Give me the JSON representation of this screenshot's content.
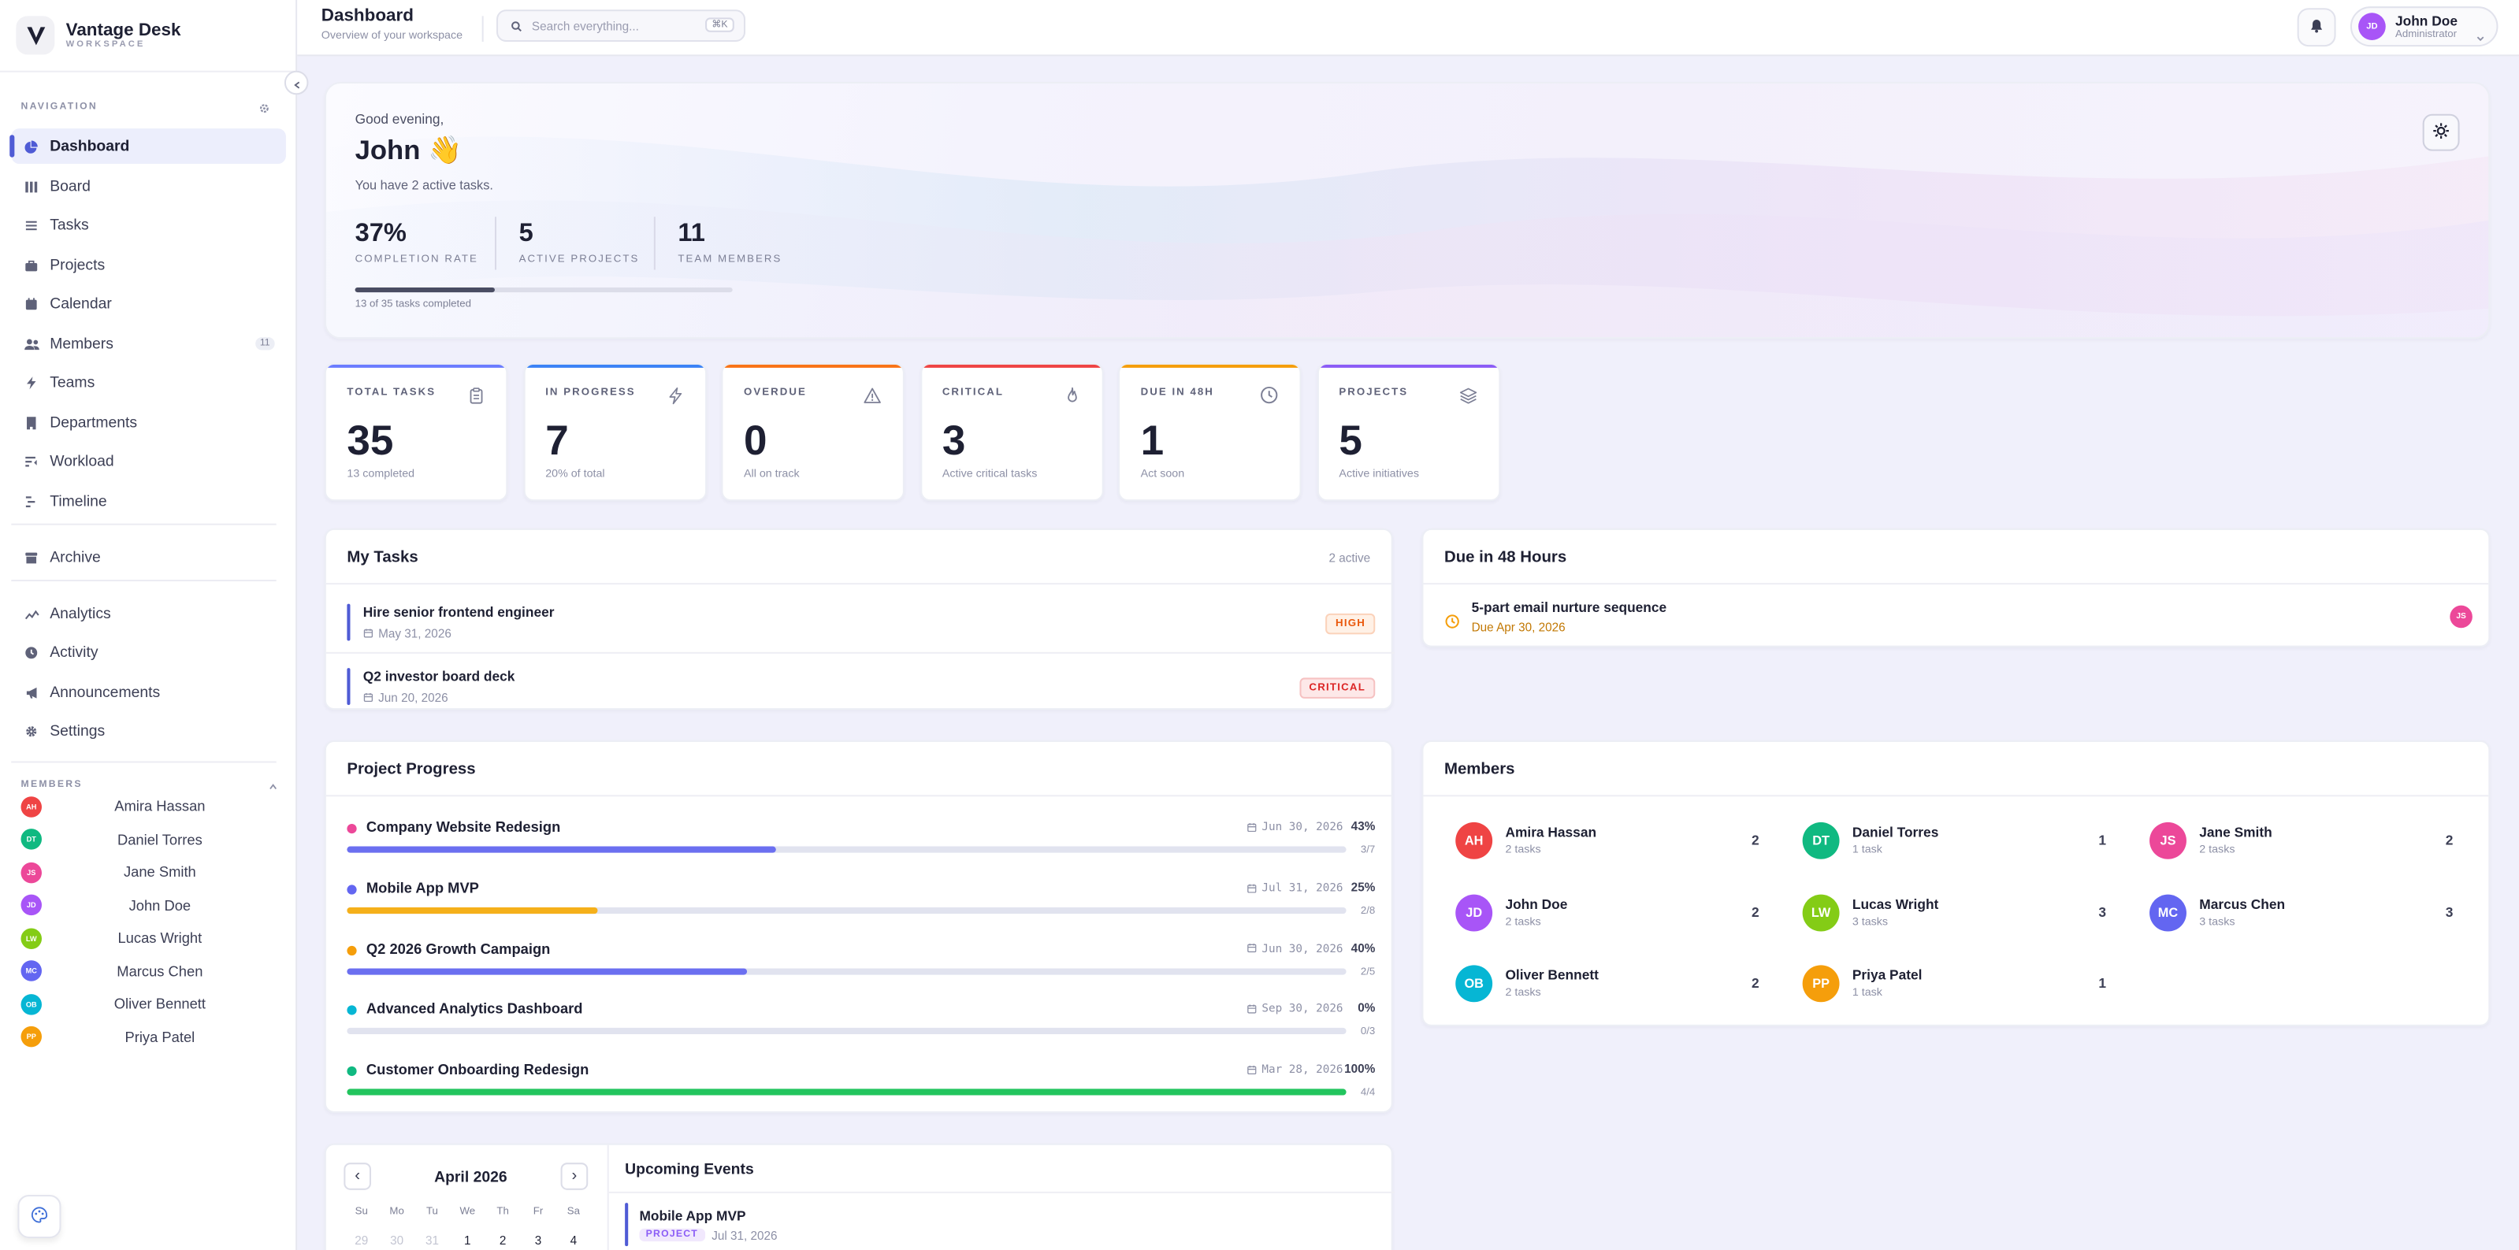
{
  "brand": {
    "name": "Vantage Desk",
    "sub": "WORKSPACE"
  },
  "nav": {
    "caption": "NAVIGATION",
    "items": [
      {
        "label": "Dashboard",
        "icon": "pie-chart-icon"
      },
      {
        "label": "Board",
        "icon": "columns-icon"
      },
      {
        "label": "Tasks",
        "icon": "list-icon"
      },
      {
        "label": "Projects",
        "icon": "briefcase-icon"
      },
      {
        "label": "Calendar",
        "icon": "calendar-icon"
      },
      {
        "label": "Members",
        "icon": "users-icon",
        "badge": "11"
      },
      {
        "label": "Teams",
        "icon": "bolt-icon"
      },
      {
        "label": "Departments",
        "icon": "building-icon"
      },
      {
        "label": "Workload",
        "icon": "workload-icon"
      },
      {
        "label": "Timeline",
        "icon": "timeline-icon"
      },
      {
        "label": "Archive",
        "icon": "archive-icon"
      },
      {
        "label": "Analytics",
        "icon": "analytics-icon"
      },
      {
        "label": "Activity",
        "icon": "clock-icon"
      },
      {
        "label": "Announcements",
        "icon": "megaphone-icon"
      },
      {
        "label": "Settings",
        "icon": "gear-icon"
      }
    ]
  },
  "sidebar_members": {
    "caption": "MEMBERS",
    "items": [
      {
        "initials": "AH",
        "name": "Amira Hassan",
        "color": "#ef4444"
      },
      {
        "initials": "DT",
        "name": "Daniel Torres",
        "color": "#10b981"
      },
      {
        "initials": "JS",
        "name": "Jane Smith",
        "color": "#ec4899"
      },
      {
        "initials": "JD",
        "name": "John Doe",
        "color": "#a855f7"
      },
      {
        "initials": "LW",
        "name": "Lucas Wright",
        "color": "#84cc16"
      },
      {
        "initials": "MC",
        "name": "Marcus Chen",
        "color": "#6366f1"
      },
      {
        "initials": "OB",
        "name": "Oliver Bennett",
        "color": "#06b6d4"
      },
      {
        "initials": "PP",
        "name": "Priya Patel",
        "color": "#f59e0b"
      }
    ]
  },
  "header": {
    "title": "Dashboard",
    "subtitle": "Overview of your workspace",
    "search_placeholder": "Search everything...",
    "shortcut": "⌘K",
    "user": {
      "initials": "JD",
      "name": "John Doe",
      "role": "Administrator",
      "color": "#a855f7"
    }
  },
  "hero": {
    "greeting": "Good evening,",
    "name": "John 👋",
    "summary": "You have 2 active tasks.",
    "stats": [
      {
        "value": "37%",
        "label": "COMPLETION RATE"
      },
      {
        "value": "5",
        "label": "ACTIVE PROJECTS"
      },
      {
        "value": "11",
        "label": "TEAM MEMBERS"
      }
    ],
    "progress": 0.37,
    "progress_label": "13 of 35 tasks completed"
  },
  "stats": [
    {
      "label": "TOTAL TASKS",
      "value": "35",
      "sub": "13 completed",
      "color": "#6b7cff",
      "icon": "clipboard-icon"
    },
    {
      "label": "IN PROGRESS",
      "value": "7",
      "sub": "20% of total",
      "color": "#3b82f6",
      "icon": "bolt-icon"
    },
    {
      "label": "OVERDUE",
      "value": "0",
      "sub": "All on track",
      "color": "#f97316",
      "icon": "warning-icon"
    },
    {
      "label": "CRITICAL",
      "value": "3",
      "sub": "Active critical tasks",
      "color": "#ef4444",
      "icon": "flame-icon"
    },
    {
      "label": "DUE IN 48H",
      "value": "1",
      "sub": "Act soon",
      "color": "#f59e0b",
      "icon": "clock-icon"
    },
    {
      "label": "PROJECTS",
      "value": "5",
      "sub": "Active initiatives",
      "color": "#8b5cf6",
      "icon": "layers-icon"
    }
  ],
  "my_tasks": {
    "title": "My Tasks",
    "meta": "2 active",
    "items": [
      {
        "title": "Hire senior frontend engineer",
        "date": "May 31, 2026",
        "priority": "HIGH",
        "pill_bg": "#fff1e6",
        "pill_fg": "#ea580c"
      },
      {
        "title": "Q2 investor board deck",
        "date": "Jun 20, 2026",
        "priority": "CRITICAL",
        "pill_bg": "#fde8e8",
        "pill_fg": "#dc2626"
      }
    ]
  },
  "due48": {
    "title": "Due in 48 Hours",
    "items": [
      {
        "title": "5-part email nurture sequence",
        "due": "Due Apr 30, 2026",
        "initials": "JS",
        "color": "#ec4899"
      }
    ]
  },
  "projects": {
    "title": "Project Progress",
    "items": [
      {
        "name": "Company Website Redesign",
        "date": "Jun 30, 2026",
        "pct": "43%",
        "progress": 0.43,
        "count": "3/7",
        "dot": "#ec4899",
        "bar": "#6b6ff0"
      },
      {
        "name": "Mobile App MVP",
        "date": "Jul 31, 2026",
        "pct": "25%",
        "progress": 0.25,
        "count": "2/8",
        "dot": "#6366f1",
        "bar": "#f5b01a"
      },
      {
        "name": "Q2 2026 Growth Campaign",
        "date": "Jun 30, 2026",
        "pct": "40%",
        "progress": 0.4,
        "count": "2/5",
        "dot": "#f59e0b",
        "bar": "#6b6ff0"
      },
      {
        "name": "Advanced Analytics Dashboard",
        "date": "Sep 30, 2026",
        "pct": "0%",
        "progress": 0,
        "count": "0/3",
        "dot": "#06b6d4",
        "bar": "#6b6ff0"
      },
      {
        "name": "Customer Onboarding Redesign",
        "date": "Mar 28, 2026",
        "pct": "100%",
        "progress": 1,
        "count": "4/4",
        "dot": "#10b981",
        "bar": "#22c55e"
      }
    ]
  },
  "members_card": {
    "title": "Members",
    "items": [
      {
        "initials": "AH",
        "name": "Amira Hassan",
        "tasks": "2 tasks",
        "count": "2",
        "color": "#ef4444"
      },
      {
        "initials": "DT",
        "name": "Daniel Torres",
        "tasks": "1 task",
        "count": "1",
        "color": "#10b981"
      },
      {
        "initials": "JS",
        "name": "Jane Smith",
        "tasks": "2 tasks",
        "count": "2",
        "color": "#ec4899"
      },
      {
        "initials": "JD",
        "name": "John Doe",
        "tasks": "2 tasks",
        "count": "2",
        "color": "#a855f7"
      },
      {
        "initials": "LW",
        "name": "Lucas Wright",
        "tasks": "3 tasks",
        "count": "3",
        "color": "#84cc16"
      },
      {
        "initials": "MC",
        "name": "Marcus Chen",
        "tasks": "3 tasks",
        "count": "3",
        "color": "#6366f1"
      },
      {
        "initials": "OB",
        "name": "Oliver Bennett",
        "tasks": "2 tasks",
        "count": "2",
        "color": "#06b6d4"
      },
      {
        "initials": "PP",
        "name": "Priya Patel",
        "tasks": "1 task",
        "count": "1",
        "color": "#f59e0b"
      }
    ]
  },
  "calendar": {
    "month": "April 2026",
    "prev": "‹",
    "next": "›",
    "weekdays": [
      "Su",
      "Mo",
      "Tu",
      "We",
      "Th",
      "Fr",
      "Sa"
    ],
    "first_row": [
      {
        "d": "29",
        "muted": true
      },
      {
        "d": "30",
        "muted": true
      },
      {
        "d": "31",
        "muted": true
      },
      {
        "d": "1",
        "muted": false
      },
      {
        "d": "2",
        "muted": false
      },
      {
        "d": "3",
        "muted": false
      },
      {
        "d": "4",
        "muted": false
      }
    ]
  },
  "events": {
    "title": "Upcoming Events",
    "items": [
      {
        "title": "Mobile App MVP",
        "tag": "PROJECT",
        "date": "Jul 31, 2026"
      }
    ]
  }
}
